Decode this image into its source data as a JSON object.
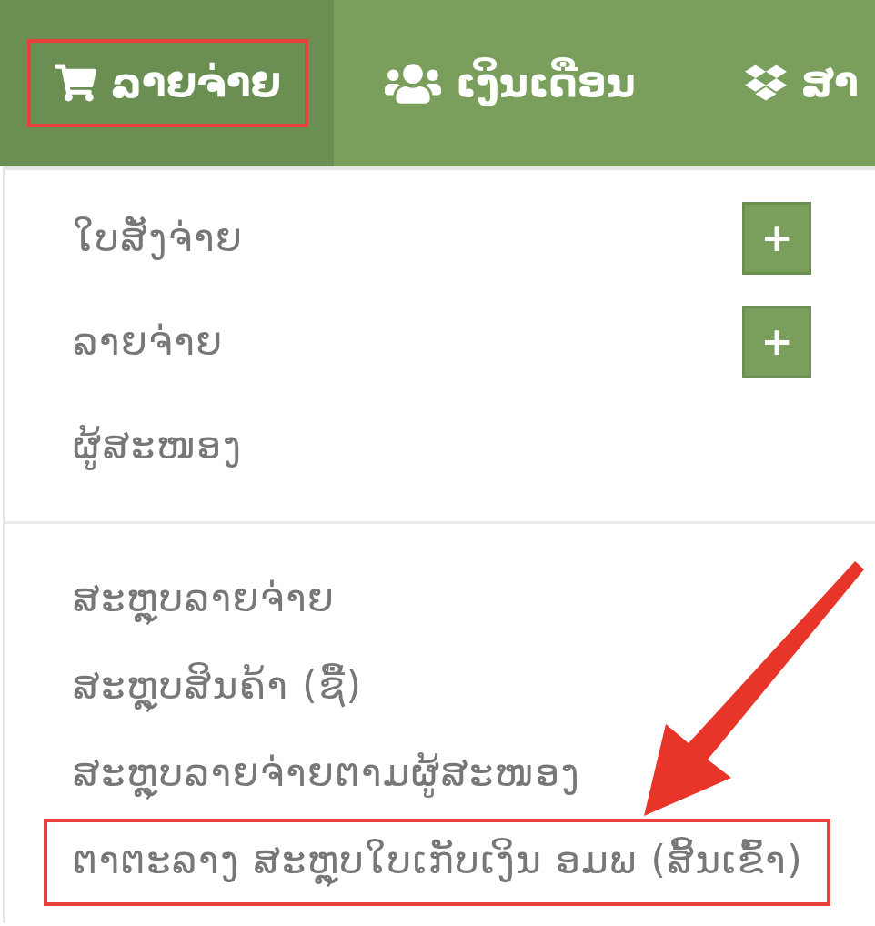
{
  "navbar": {
    "tabs": [
      {
        "label": "ລາຍຈ່າຍ",
        "selected": true,
        "highlighted": true
      },
      {
        "label": "ເງິນເດືອນ",
        "selected": false,
        "highlighted": false
      },
      {
        "label": "ສາ",
        "selected": false,
        "highlighted": false
      }
    ]
  },
  "dropdown": {
    "groups": [
      {
        "items": [
          {
            "label": "ໃບສັ່ງຈ່າຍ",
            "add_button": "+",
            "highlighted": false
          },
          {
            "label": "ລາຍຈ່າຍ",
            "add_button": "+",
            "highlighted": false
          },
          {
            "label": "ຜູ້ສະໜອງ",
            "highlighted": false
          }
        ]
      },
      {
        "items": [
          {
            "label": "ສະຫຼຸບລາຍຈ່າຍ",
            "highlighted": false
          },
          {
            "label": "ສະຫຼຸບສິນຄ້າ (ຊື້)",
            "highlighted": false
          },
          {
            "label": "ສະຫຼຸບລາຍຈ່າຍຕາມຜູ້ສະໜອງ",
            "highlighted": false
          },
          {
            "label": "ຕາຕະລາງ ສະຫຼຸບໃບເກັບເງິນ ອມພ (ສິ້ນເຂົ້າ)",
            "highlighted": true
          }
        ]
      }
    ]
  },
  "pointer_arrow": true
}
